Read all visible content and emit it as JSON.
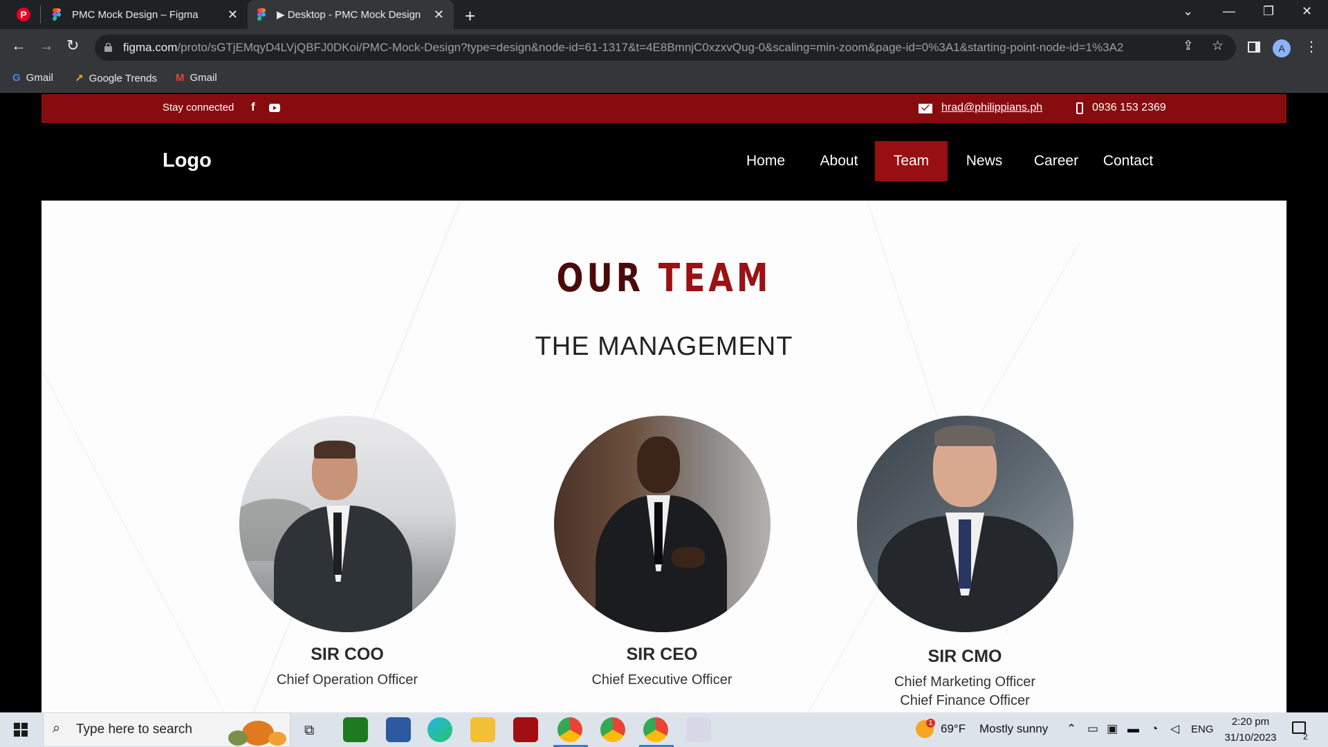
{
  "browser": {
    "tabs": [
      {
        "title": "PMC Mock Design – Figma",
        "active": false
      },
      {
        "title": "▶ Desktop - PMC Mock Design",
        "active": true
      }
    ],
    "url_host": "figma.com",
    "url_rest": "/proto/sGTjEMqyD4LVjQBFJ0DKoi/PMC-Mock-Design?type=design&node-id=61-1317&t=4E8BmnjC0xzxvQug-0&scaling=min-zoom&page-id=0%3A1&starting-point-node-id=1%3A2",
    "profile_initial": "A",
    "bookmarks": [
      {
        "label": "Gmail",
        "icon": "google-icon"
      },
      {
        "label": "Google Trends",
        "icon": "trends-icon"
      },
      {
        "label": "Gmail",
        "icon": "gmail-icon"
      }
    ]
  },
  "site": {
    "topbar": {
      "stay_connected": "Stay connected",
      "email": "hrad@philippians.ph",
      "phone": "0936 153 2369"
    },
    "logo": "Logo",
    "nav": [
      {
        "label": "Home",
        "active": false
      },
      {
        "label": "About",
        "active": false
      },
      {
        "label": "Team",
        "active": true
      },
      {
        "label": "News",
        "active": false
      },
      {
        "label": "Career",
        "active": false
      },
      {
        "label": "Contact",
        "active": false
      }
    ],
    "heading_word1": "OUR",
    "heading_word2": "TEAM",
    "subheading": "THE MANAGEMENT",
    "members": [
      {
        "name": "SIR COO",
        "roles": [
          "Chief Operation Officer"
        ]
      },
      {
        "name": "SIR CEO",
        "roles": [
          "Chief Executive Officer"
        ]
      },
      {
        "name": "SIR CMO",
        "roles": [
          "Chief Marketing Officer",
          "Chief Finance Officer"
        ]
      }
    ],
    "accent_color": "#870c0e"
  },
  "taskbar": {
    "search_placeholder": "Type here to search",
    "weather_temp": "69°F",
    "weather_desc": "Mostly sunny",
    "language": "ENG",
    "time": "2:20 pm",
    "date": "31/10/2023",
    "notification_count": "2",
    "weather_badge": "1"
  }
}
